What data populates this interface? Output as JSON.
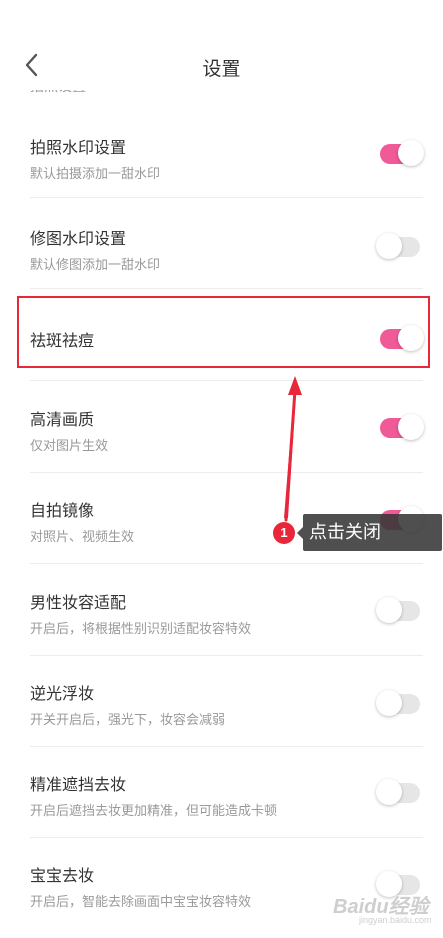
{
  "header": {
    "title": "设置",
    "clipped_label": "拍照设置"
  },
  "rows": [
    {
      "title": "拍照水印设置",
      "subtitle": "默认拍摄添加一甜水印",
      "toggle": "on"
    },
    {
      "title": "修图水印设置",
      "subtitle": "默认修图添加一甜水印",
      "toggle": "off"
    },
    {
      "title": "祛斑祛痘",
      "subtitle": "",
      "toggle": "on"
    },
    {
      "title": "高清画质",
      "subtitle": "仅对图片生效",
      "toggle": "on"
    },
    {
      "title": "自拍镜像",
      "subtitle": "对照片、视频生效",
      "toggle": "on"
    },
    {
      "title": "男性妆容适配",
      "subtitle": "开启后，将根据性别识别适配妆容特效",
      "toggle": "off"
    },
    {
      "title": "逆光浮妆",
      "subtitle": "开关开启后，强光下，妆容会减弱",
      "toggle": "off"
    },
    {
      "title": "精准遮挡去妆",
      "subtitle": "开启后遮挡去妆更加精准，但可能造成卡顿",
      "toggle": "off"
    },
    {
      "title": "宝宝去妆",
      "subtitle": "开启后，智能去除画面中宝宝妆容特效",
      "toggle": "off"
    }
  ],
  "annotation": {
    "step_number": "1",
    "tooltip": "点击关闭"
  },
  "watermark": {
    "logo": "Baidu经验",
    "sub": "jingyan.baidu.com"
  },
  "colors": {
    "toggle_on": "#f05a96",
    "toggle_off": "#e6e6e6",
    "highlight": "#e8283a"
  }
}
